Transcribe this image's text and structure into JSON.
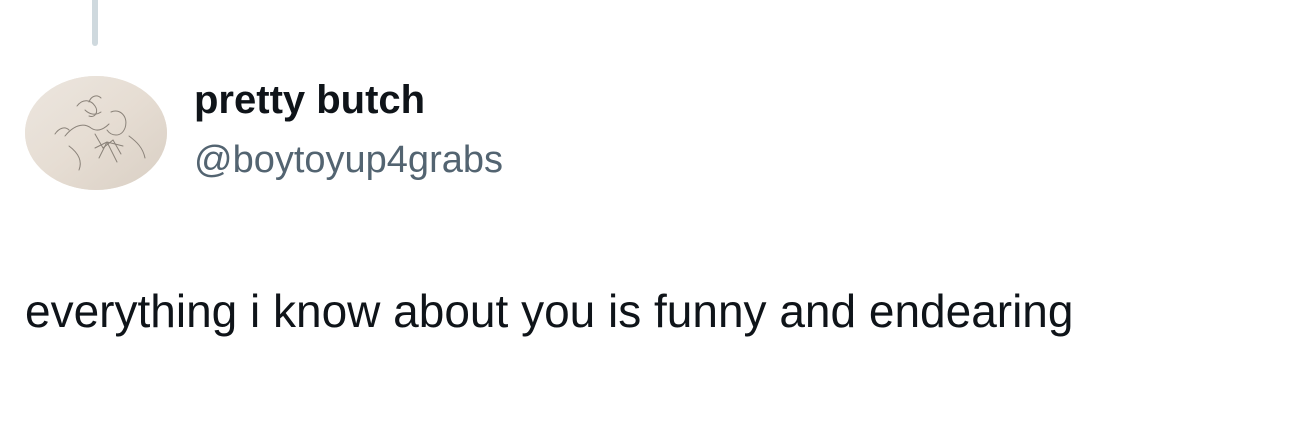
{
  "tweet": {
    "author": {
      "display_name": "pretty butch",
      "handle": "@boytoyup4grabs",
      "avatar": "sketch-drawing-avatar"
    },
    "text": "everything i know about you is funny and endearing"
  },
  "colors": {
    "text_primary": "#0f1419",
    "text_secondary": "#536471",
    "thread_line": "#cfd9de",
    "background": "#ffffff"
  }
}
